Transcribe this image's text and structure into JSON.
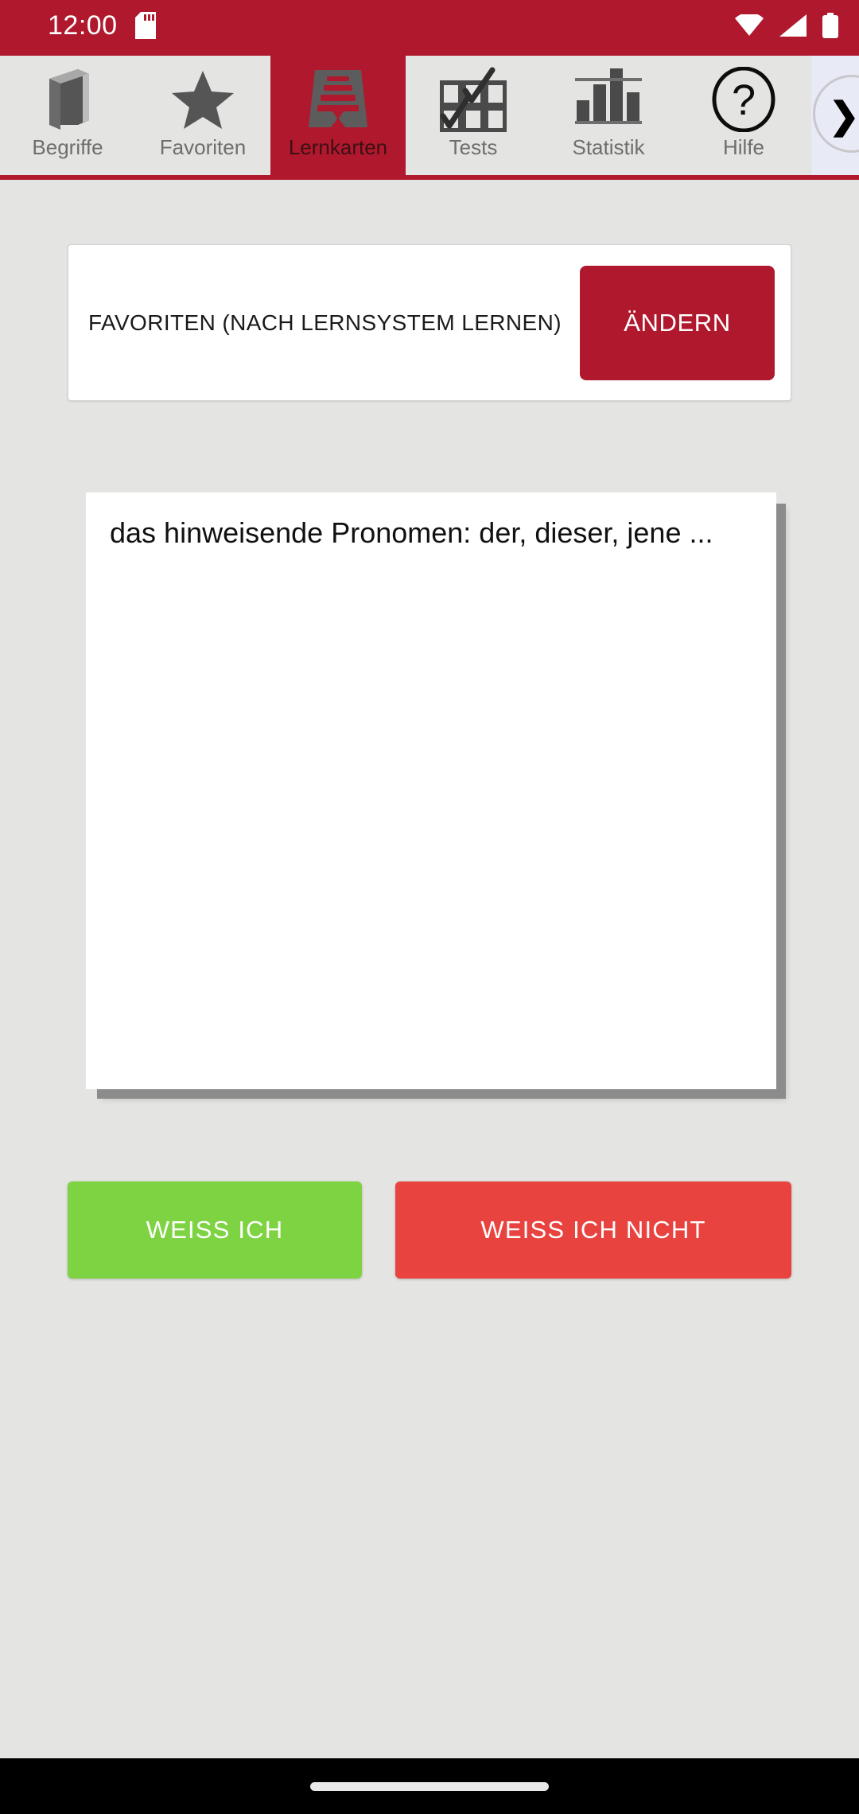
{
  "status_bar": {
    "clock": "12:00",
    "background_color": "#b0182e",
    "icons": {
      "storage": "sd-card-icon",
      "wifi": "wifi-icon",
      "signal": "cellular-signal-icon",
      "battery": "battery-icon"
    }
  },
  "tab_bar": {
    "active_index": 2,
    "active_background_color": "#b0182e",
    "inactive_background_color": "#e4e4e2",
    "tabs": [
      {
        "label": "Begriffe",
        "icon": "book-icon"
      },
      {
        "label": "Favoriten",
        "icon": "star-icon"
      },
      {
        "label": "Lernkarten",
        "icon": "card-box-icon"
      },
      {
        "label": "Tests",
        "icon": "checklist-icon"
      },
      {
        "label": "Statistik",
        "icon": "bar-chart-icon"
      },
      {
        "label": "Hilfe",
        "icon": "question-mark-circle-icon"
      }
    ],
    "scroll_hint_icon": "chevron-right-icon"
  },
  "header": {
    "title": "FAVORITEN (NACH LERNSYSTEM LERNEN)",
    "change_button_label": "ÄNDERN",
    "change_button_color": "#b0182e"
  },
  "flashcard": {
    "text": "das hinweisende Pronomen: der, dieser, jene ..."
  },
  "answers": {
    "know_label": "WEISS ICH",
    "know_color": "#7ed342",
    "dont_know_label": "WEISS ICH NICHT",
    "dont_know_color": "#e8433f"
  },
  "nav_bar": {
    "gesture_pill": "home-gesture-pill"
  }
}
